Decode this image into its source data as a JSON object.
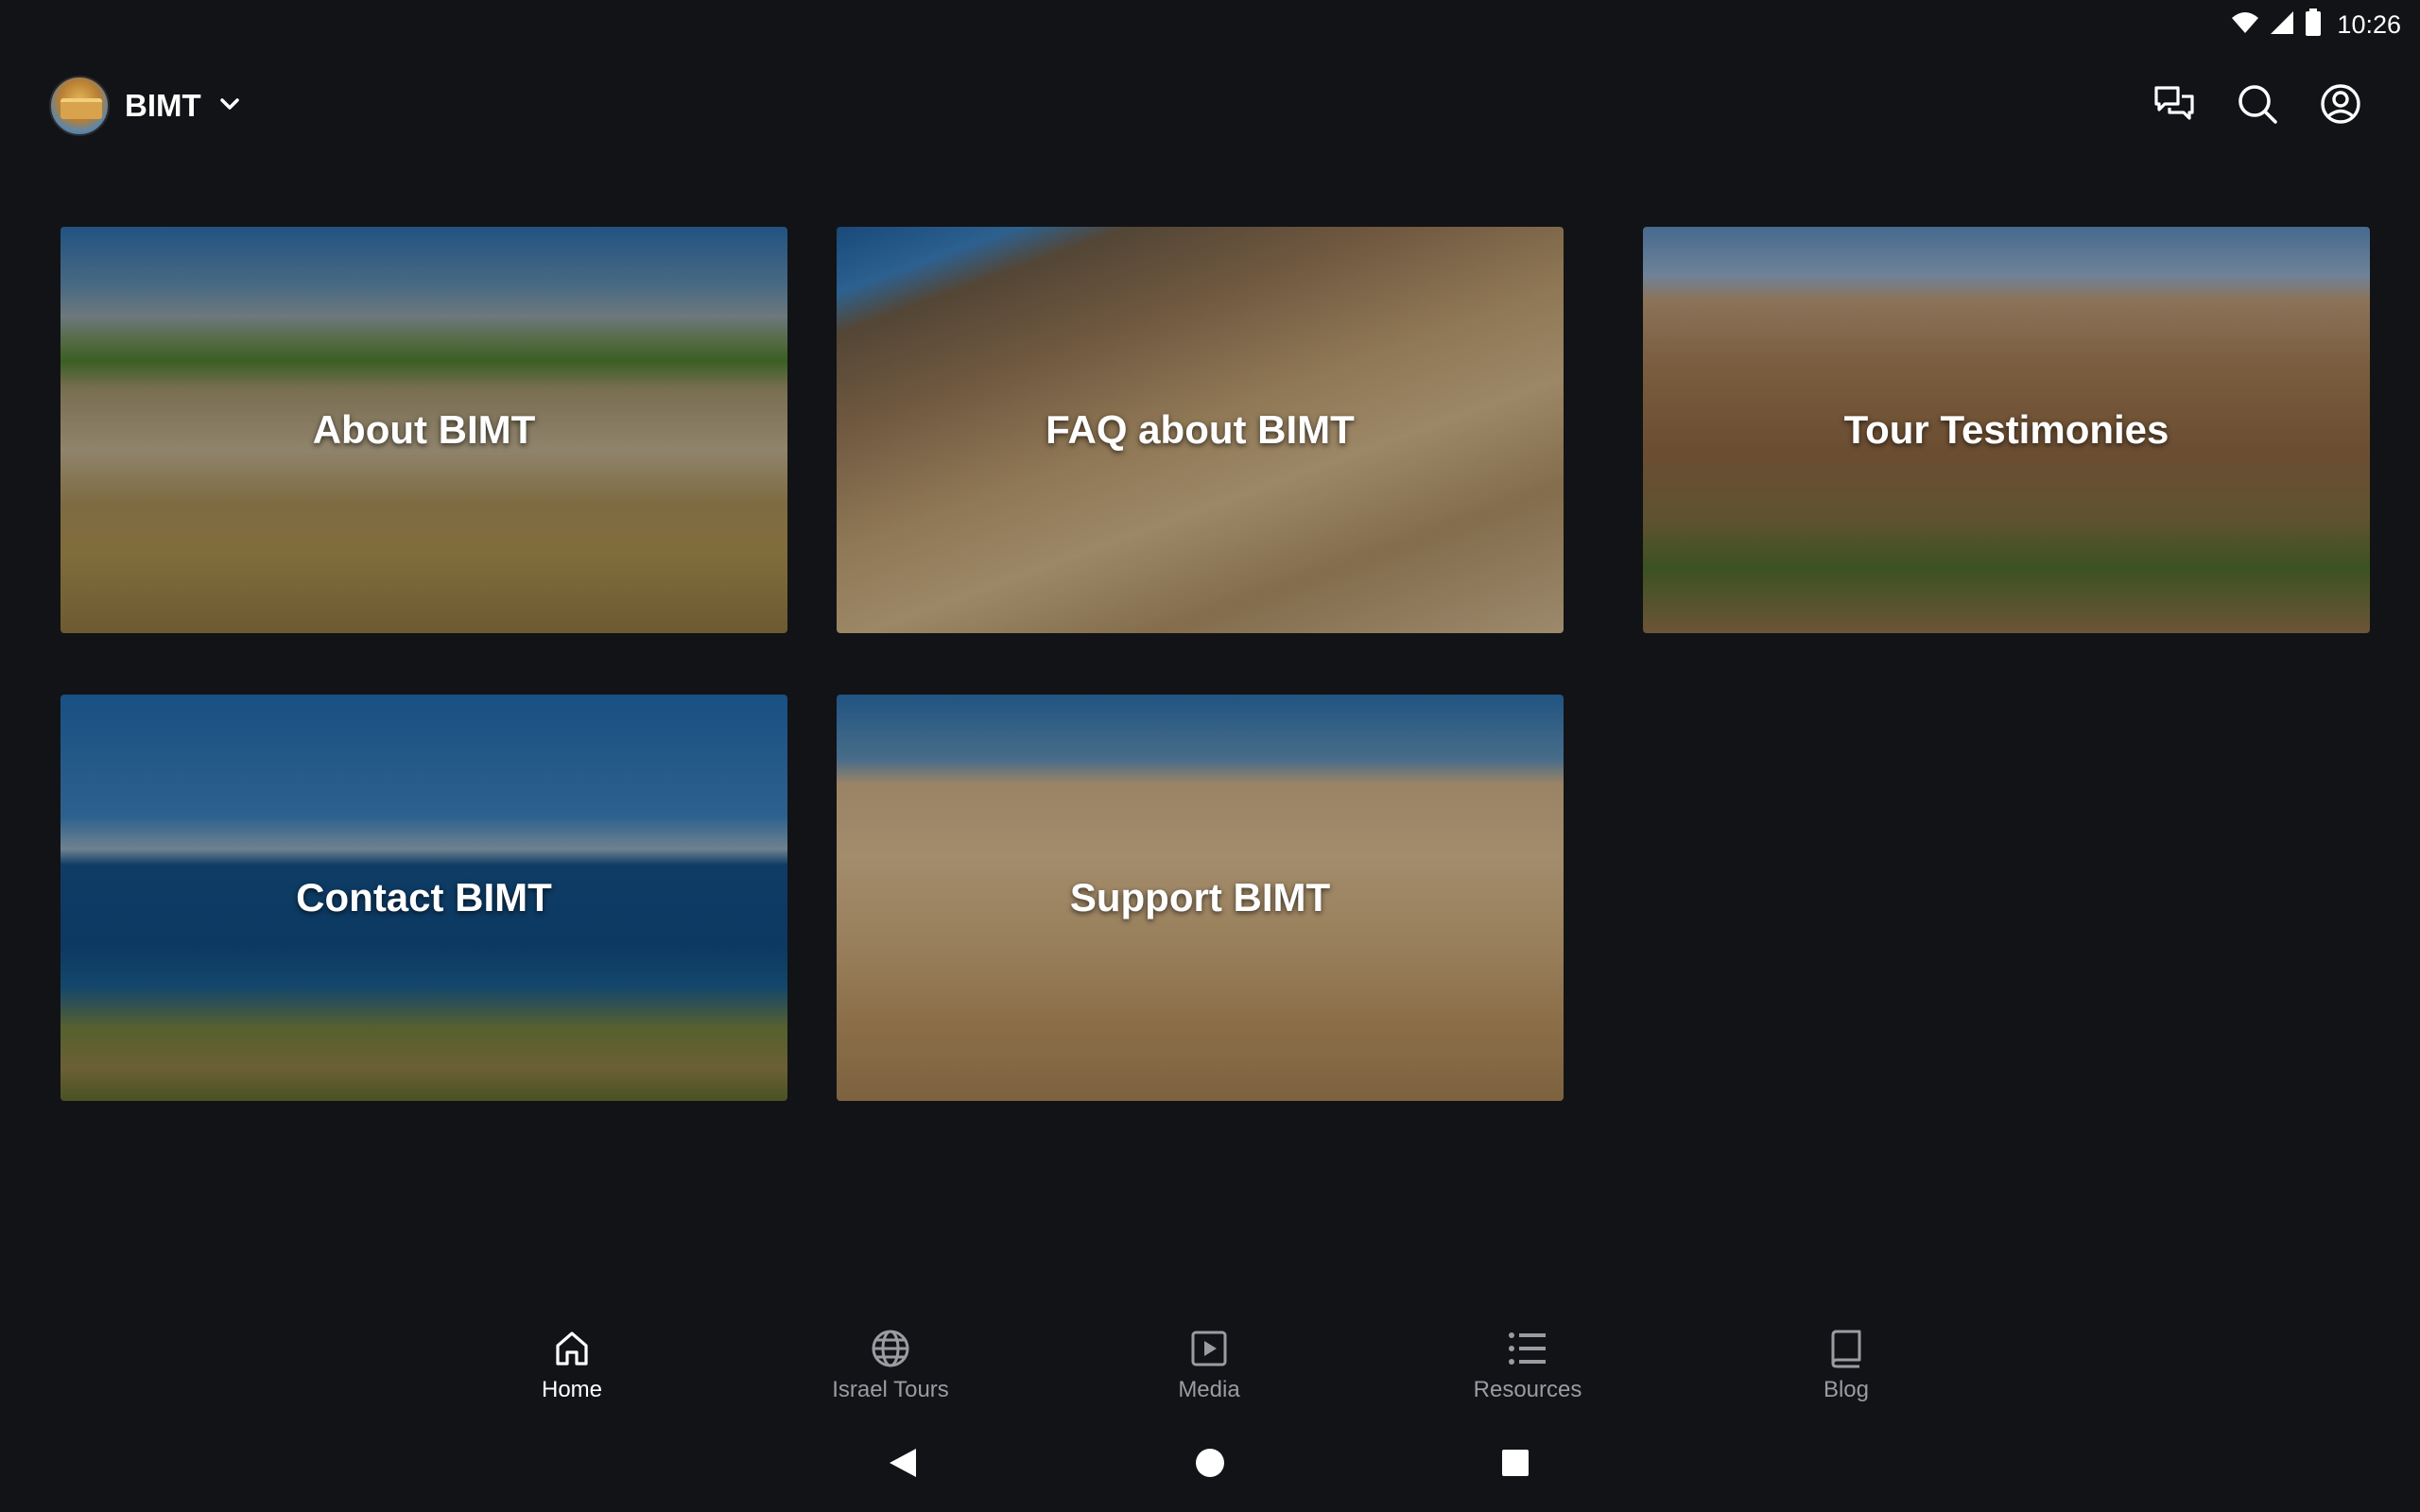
{
  "status_bar": {
    "time": "10:26",
    "icons": [
      "wifi-icon",
      "cell-signal-icon",
      "battery-icon"
    ]
  },
  "app_bar": {
    "brand_name": "BIMT",
    "brand_icon": "chevron-down-icon",
    "actions": [
      "chat-icon",
      "search-icon",
      "account-icon"
    ]
  },
  "tiles": [
    {
      "title": "About BIMT"
    },
    {
      "title": "FAQ about BIMT"
    },
    {
      "title": "Tour Testimonies"
    },
    {
      "title": "Contact BIMT"
    },
    {
      "title": "Support BIMT"
    }
  ],
  "bottom_nav": {
    "items": [
      {
        "label": "Home",
        "icon": "home-icon",
        "active": true
      },
      {
        "label": "Israel Tours",
        "icon": "globe-icon",
        "active": false
      },
      {
        "label": "Media",
        "icon": "play-icon",
        "active": false
      },
      {
        "label": "Resources",
        "icon": "list-icon",
        "active": false
      },
      {
        "label": "Blog",
        "icon": "book-icon",
        "active": false
      }
    ]
  },
  "system_nav": [
    "back-icon",
    "home-circle-icon",
    "recents-icon"
  ],
  "colors": {
    "background": "#121316",
    "text_primary": "#ffffff",
    "text_secondary": "#9a9ca2"
  }
}
